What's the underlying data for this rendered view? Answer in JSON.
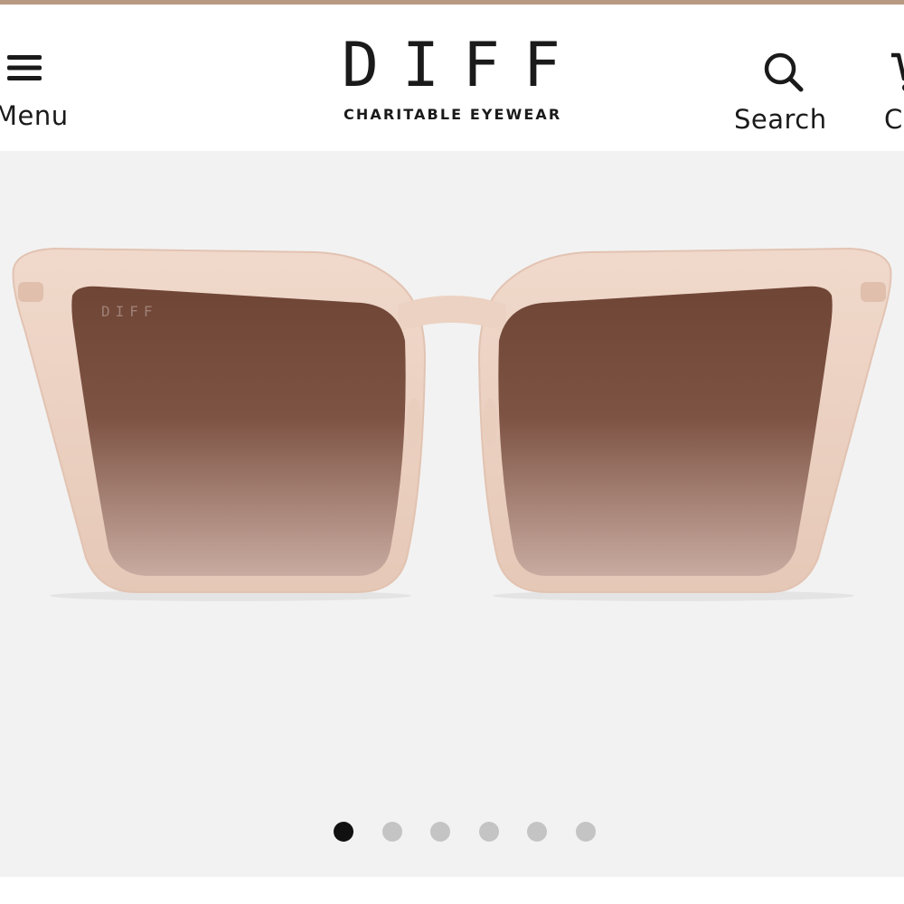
{
  "header": {
    "menu_label": "Menu",
    "menu_icon": "hamburger-icon",
    "logo_word": "DIFF",
    "logo_tagline": "CHARITABLE EYEWEAR",
    "search_label": "Search",
    "search_icon": "search-icon",
    "cart_label": "C",
    "cart_icon": "cart-icon"
  },
  "product": {
    "lens_logo": "DIFF",
    "frame_color": "#ecd2c2",
    "lens_top_color": "#6f4536",
    "lens_bottom_color": "#c9aba1",
    "background": "#f2f2f2"
  },
  "carousel": {
    "total": 6,
    "active_index": 0,
    "active_color": "#111111",
    "inactive_color": "#c4c4c4"
  },
  "colors": {
    "top_bar": "#b89a83",
    "text": "#1a1a1a"
  }
}
